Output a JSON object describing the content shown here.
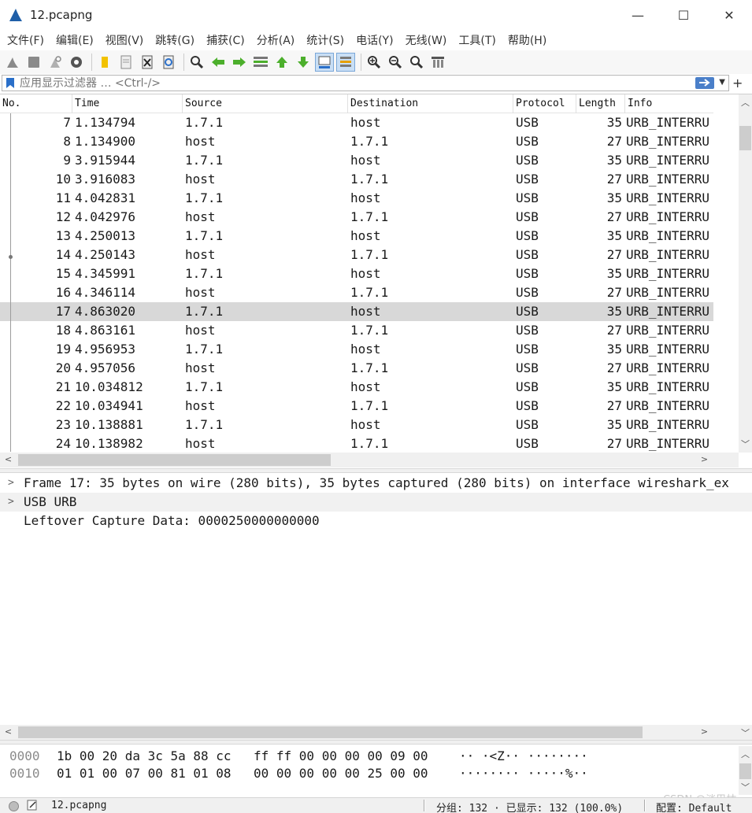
{
  "window": {
    "title": "12.pcapng",
    "controls": {
      "minimize": "—",
      "maximize": "☐",
      "close": "✕"
    }
  },
  "menu": [
    "文件(F)",
    "编辑(E)",
    "视图(V)",
    "跳转(G)",
    "捕获(C)",
    "分析(A)",
    "统计(S)",
    "电话(Y)",
    "无线(W)",
    "工具(T)",
    "帮助(H)"
  ],
  "toolbar": {
    "icons": [
      "shark-fin-start-icon",
      "stop-square-icon",
      "restart-fin-icon",
      "capture-options-gear-icon",
      "open-folder-icon",
      "save-file-icon",
      "close-file-icon",
      "reload-icon",
      "find-magnifier-icon",
      "go-back-arrow-icon",
      "go-forward-arrow-icon",
      "go-to-packet-icon",
      "go-first-packet-icon",
      "go-last-packet-icon",
      "auto-scroll-icon",
      "colorize-icon",
      "zoom-in-icon",
      "zoom-out-icon",
      "zoom-normal-icon",
      "resize-columns-icon"
    ],
    "active": [
      "auto-scroll-icon",
      "colorize-icon"
    ]
  },
  "filter": {
    "placeholder": "应用显示过滤器 … <Ctrl-/>",
    "add_label": "+"
  },
  "packet_list": {
    "columns": [
      "No.",
      "Time",
      "Source",
      "Destination",
      "Protocol",
      "Length",
      "Info"
    ],
    "rows": [
      {
        "no": "7",
        "time": "1.134794",
        "src": "1.7.1",
        "dst": "host",
        "proto": "USB",
        "len": "35",
        "info": "URB_INTERRU"
      },
      {
        "no": "8",
        "time": "1.134900",
        "src": "host",
        "dst": "1.7.1",
        "proto": "USB",
        "len": "27",
        "info": "URB_INTERRU"
      },
      {
        "no": "9",
        "time": "3.915944",
        "src": "1.7.1",
        "dst": "host",
        "proto": "USB",
        "len": "35",
        "info": "URB_INTERRU"
      },
      {
        "no": "10",
        "time": "3.916083",
        "src": "host",
        "dst": "1.7.1",
        "proto": "USB",
        "len": "27",
        "info": "URB_INTERRU"
      },
      {
        "no": "11",
        "time": "4.042831",
        "src": "1.7.1",
        "dst": "host",
        "proto": "USB",
        "len": "35",
        "info": "URB_INTERRU"
      },
      {
        "no": "12",
        "time": "4.042976",
        "src": "host",
        "dst": "1.7.1",
        "proto": "USB",
        "len": "27",
        "info": "URB_INTERRU"
      },
      {
        "no": "13",
        "time": "4.250013",
        "src": "1.7.1",
        "dst": "host",
        "proto": "USB",
        "len": "35",
        "info": "URB_INTERRU"
      },
      {
        "no": "14",
        "time": "4.250143",
        "src": "host",
        "dst": "1.7.1",
        "proto": "USB",
        "len": "27",
        "info": "URB_INTERRU"
      },
      {
        "no": "15",
        "time": "4.345991",
        "src": "1.7.1",
        "dst": "host",
        "proto": "USB",
        "len": "35",
        "info": "URB_INTERRU"
      },
      {
        "no": "16",
        "time": "4.346114",
        "src": "host",
        "dst": "1.7.1",
        "proto": "USB",
        "len": "27",
        "info": "URB_INTERRU"
      },
      {
        "no": "17",
        "time": "4.863020",
        "src": "1.7.1",
        "dst": "host",
        "proto": "USB",
        "len": "35",
        "info": "URB_INTERRU"
      },
      {
        "no": "18",
        "time": "4.863161",
        "src": "host",
        "dst": "1.7.1",
        "proto": "USB",
        "len": "27",
        "info": "URB_INTERRU"
      },
      {
        "no": "19",
        "time": "4.956953",
        "src": "1.7.1",
        "dst": "host",
        "proto": "USB",
        "len": "35",
        "info": "URB_INTERRU"
      },
      {
        "no": "20",
        "time": "4.957056",
        "src": "host",
        "dst": "1.7.1",
        "proto": "USB",
        "len": "27",
        "info": "URB_INTERRU"
      },
      {
        "no": "21",
        "time": "10.034812",
        "src": "1.7.1",
        "dst": "host",
        "proto": "USB",
        "len": "35",
        "info": "URB_INTERRU"
      },
      {
        "no": "22",
        "time": "10.034941",
        "src": "host",
        "dst": "1.7.1",
        "proto": "USB",
        "len": "27",
        "info": "URB_INTERRU"
      },
      {
        "no": "23",
        "time": "10.138881",
        "src": "1.7.1",
        "dst": "host",
        "proto": "USB",
        "len": "35",
        "info": "URB_INTERRU"
      },
      {
        "no": "24",
        "time": "10.138982",
        "src": "host",
        "dst": "1.7.1",
        "proto": "USB",
        "len": "27",
        "info": "URB_INTERRU"
      }
    ],
    "selected_no": "17"
  },
  "details": [
    {
      "expander": true,
      "text": "Frame 17: 35 bytes on wire (280 bits), 35 bytes captured (280 bits) on interface wireshark_ex"
    },
    {
      "expander": true,
      "text": "USB URB"
    },
    {
      "expander": false,
      "text": "Leftover Capture Data: 0000250000000000"
    }
  ],
  "bytes": [
    {
      "offset": "0000",
      "hex1": "1b 00 20 da 3c 5a 88 cc",
      "hex2": "ff ff 00 00 00 00 09 00",
      "ascii": "·· ·<Z·· ········"
    },
    {
      "offset": "0010",
      "hex1": "01 01 00 07 00 81 01 08",
      "hex2": "00 00 00 00 00 25 00 00",
      "ascii": "········ ·····%··"
    }
  ],
  "status": {
    "file": "12.pcapng",
    "packets": "分组: 132 · 已显示: 132 (100.0%)",
    "profile": "配置: Default"
  },
  "watermark": "CSDN @淡巴枯",
  "colors": {
    "selected_row": "#d8d8d8",
    "accent_blue": "#4a7fc9"
  }
}
